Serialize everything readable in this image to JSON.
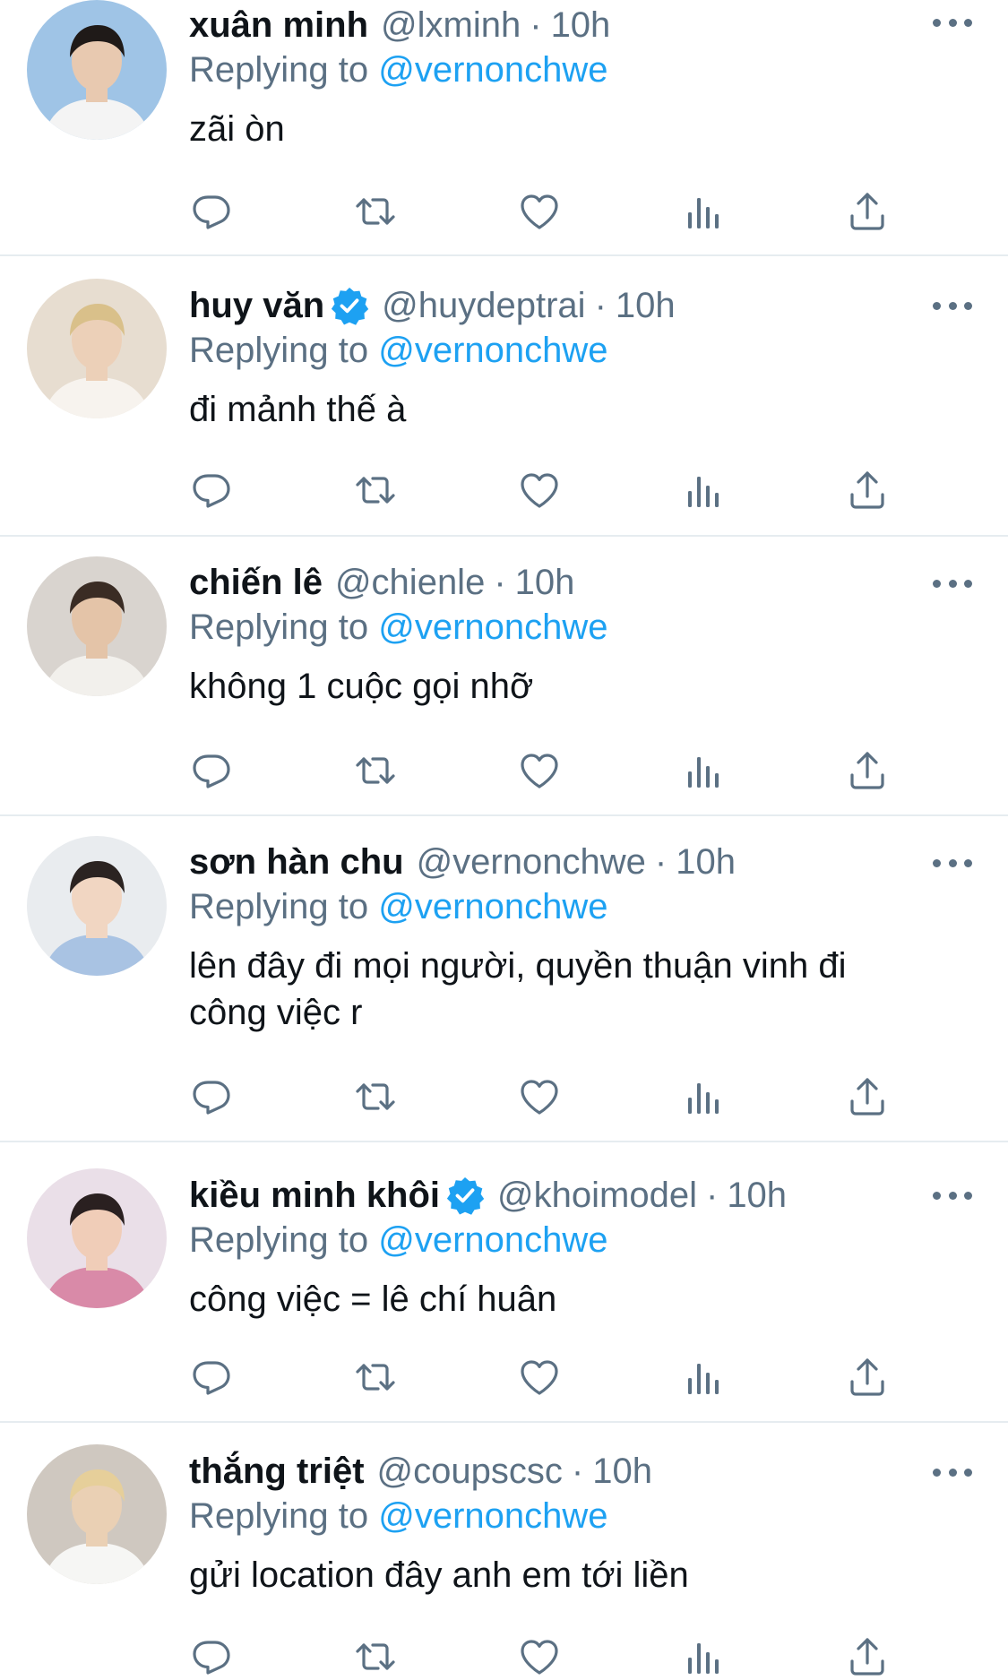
{
  "feed": {
    "tweets": [
      {
        "display_name": "xuân minh",
        "verified": false,
        "handle": "@lxminh",
        "time": "10h",
        "replying_label": "Replying to",
        "reply_target": "@vernonchwe",
        "body_lines": [
          "zãi òn"
        ],
        "avatar_colors": [
          "#9fc4e6",
          "#e8c9b0",
          "#1f1a18",
          "#f4f4f4"
        ]
      },
      {
        "display_name": "huy văn",
        "verified": true,
        "handle": "@huydeptrai",
        "time": "10h",
        "replying_label": "Replying to",
        "reply_target": "@vernonchwe",
        "body_lines": [
          "đi mảnh thế à"
        ],
        "avatar_colors": [
          "#e7ddd0",
          "#ecd0b8",
          "#d9c08a",
          "#f7f3ee"
        ]
      },
      {
        "display_name": "chiến lê",
        "verified": false,
        "handle": "@chienle",
        "time": "10h",
        "replying_label": "Replying to",
        "reply_target": "@vernonchwe",
        "body_lines": [
          "không 1 cuộc gọi nhỡ"
        ],
        "avatar_colors": [
          "#d9d4cf",
          "#e4c4a8",
          "#3a2c24",
          "#f2f0ec"
        ]
      },
      {
        "display_name": "sơn hàn chu",
        "verified": false,
        "handle": "@vernonchwe",
        "time": "10h",
        "replying_label": "Replying to",
        "reply_target": "@vernonchwe",
        "body_lines": [
          "lên đây đi mọi người, quyền thuận vinh đi",
          "công việc r"
        ],
        "avatar_colors": [
          "#e9ecef",
          "#f1d6c2",
          "#2b2321",
          "#a9c3e3"
        ]
      },
      {
        "display_name": "kiều minh khôi",
        "verified": true,
        "handle": "@khoimodel",
        "time": "10h",
        "replying_label": "Replying to",
        "reply_target": "@vernonchwe",
        "body_lines": [
          "công việc = lê chí huân"
        ],
        "avatar_colors": [
          "#eadfe8",
          "#f0cdb8",
          "#2a2020",
          "#d98aa8"
        ]
      },
      {
        "display_name": "thắng triệt",
        "verified": false,
        "handle": "@coupscsc",
        "time": "10h",
        "replying_label": "Replying to",
        "reply_target": "@vernonchwe",
        "body_lines": [
          "gửi location đây anh em tới liền"
        ],
        "avatar_colors": [
          "#cfc8c0",
          "#ead0b4",
          "#e6cf9a",
          "#f6f6f4"
        ]
      }
    ]
  },
  "icons": {
    "more": "more-icon",
    "verified": "verified-badge-icon",
    "reply": "reply-icon",
    "retweet": "retweet-icon",
    "like": "like-icon",
    "stats": "stats-icon",
    "share": "share-icon"
  },
  "colors": {
    "text": "#0f1419",
    "muted": "#5b7083",
    "accent": "#1da1f2",
    "divider": "#e6ecf0"
  }
}
